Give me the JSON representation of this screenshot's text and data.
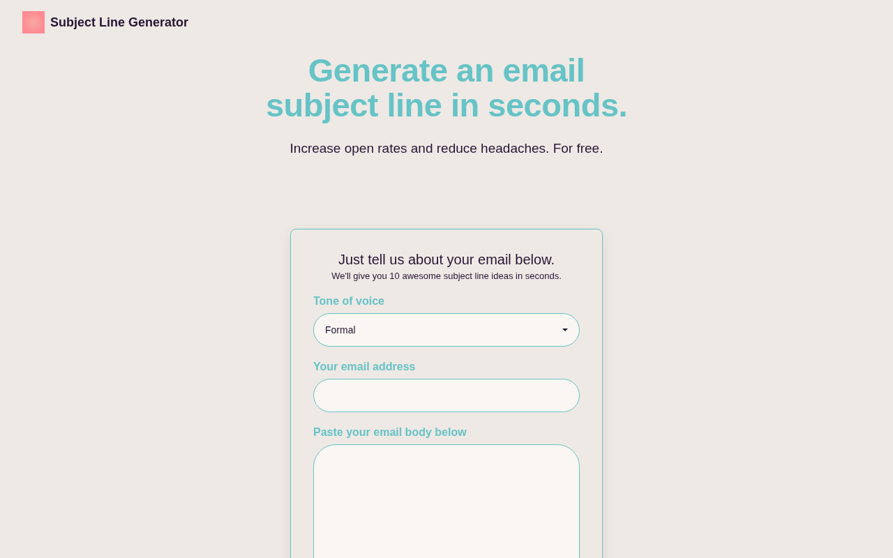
{
  "header": {
    "title": "Subject Line Generator"
  },
  "hero": {
    "headline_lines": [
      "Generate an email",
      "subject line in seconds."
    ],
    "subtitle": "Increase open rates and reduce headaches. For free."
  },
  "form": {
    "title": "Just tell us about your email below.",
    "subtitle": "We'll give you 10 awesome subject line ideas in seconds.",
    "fields": [
      {
        "kind": "select",
        "label": "Tone of voice",
        "value": "Formal"
      },
      {
        "kind": "input",
        "label": "Your email address"
      },
      {
        "kind": "textarea",
        "label": "Paste your email body below"
      }
    ]
  }
}
